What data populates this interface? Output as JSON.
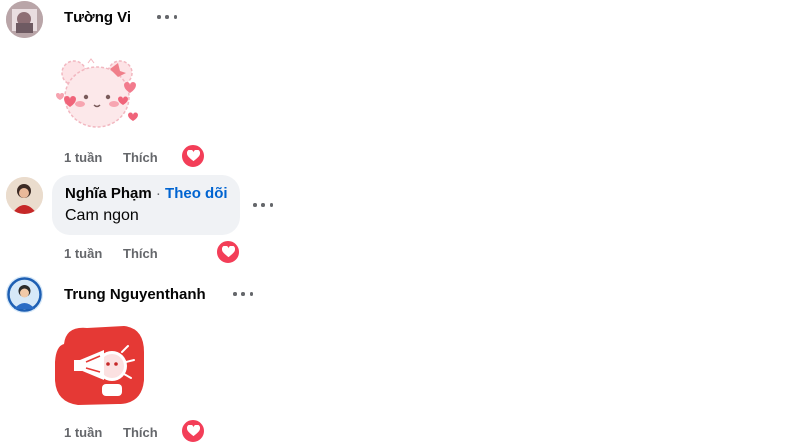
{
  "comments": [
    {
      "author": "Tường Vi",
      "type": "sticker",
      "sticker": "pink-bear-hearts-sticker",
      "time": "1 tuần",
      "like_label": "Thích",
      "reaction": "love"
    },
    {
      "author": "Nghĩa Phạm",
      "follow_separator": " · ",
      "follow_label": "Theo dõi",
      "type": "text",
      "text": "Cam ngon",
      "time": "1 tuần",
      "like_label": "Thích",
      "reaction": "love"
    },
    {
      "author": "Trung Nguyenthanh",
      "type": "sticker",
      "sticker": "megaphone-character-sticker",
      "time": "1 tuần",
      "like_label": "Thích",
      "reaction": "love"
    }
  ],
  "colors": {
    "love_reaction": "#f33e58",
    "follow_link": "#0064d1",
    "bubble_bg": "#f0f2f5",
    "meta_text": "#65676b",
    "sticker_red": "#e53935"
  }
}
